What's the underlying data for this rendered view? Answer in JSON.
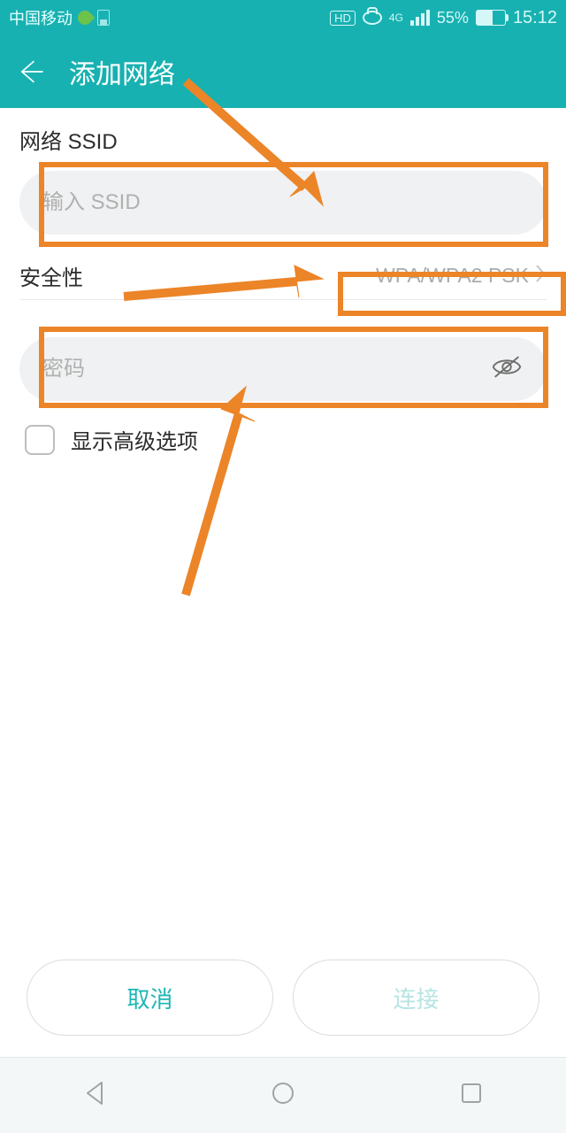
{
  "status": {
    "carrier": "中国移动",
    "hd": "HD",
    "net": "4G",
    "battery_pct": "55%",
    "time": "15:12"
  },
  "header": {
    "title": "添加网络"
  },
  "form": {
    "ssid_label": "网络 SSID",
    "ssid_placeholder": "输入 SSID",
    "security_label": "安全性",
    "security_value": "WPA/WPA2 PSK",
    "password_placeholder": "密码",
    "advanced_label": "显示高级选项"
  },
  "actions": {
    "cancel": "取消",
    "connect": "连接"
  },
  "annotation": {
    "highlight_color": "#ec8428"
  }
}
